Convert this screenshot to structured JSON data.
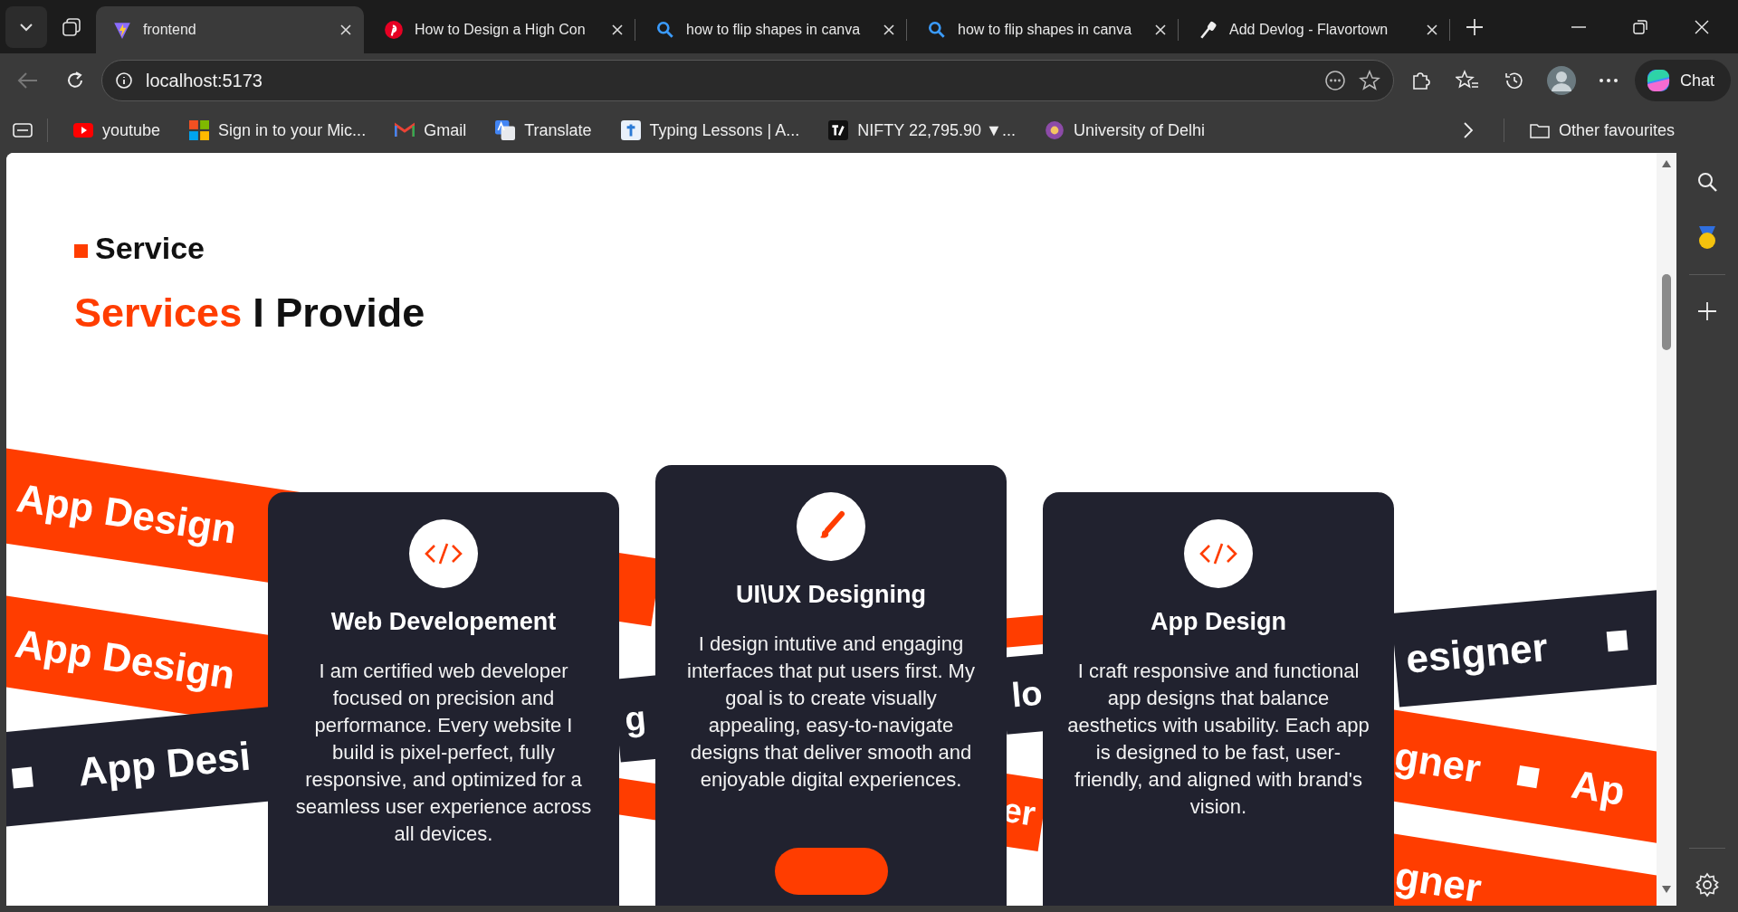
{
  "browser": {
    "tabs": [
      {
        "title": "frontend",
        "selected": true,
        "kind": "vite"
      },
      {
        "title": "How to Design a High Con",
        "selected": false,
        "kind": "pinterest"
      },
      {
        "title": "how to flip shapes in canva",
        "selected": false,
        "kind": "search"
      },
      {
        "title": "how to flip shapes in canva",
        "selected": false,
        "kind": "search"
      },
      {
        "title": "Add Devlog - Flavortown",
        "selected": false,
        "kind": "flavortown"
      }
    ],
    "back_disabled": true,
    "address": "localhost:5173",
    "chat_label": "Chat",
    "bookmarks": [
      {
        "label": "youtube",
        "kind": "youtube"
      },
      {
        "label": "Sign in to your Mic...",
        "kind": "microsoft"
      },
      {
        "label": "Gmail",
        "kind": "gmail"
      },
      {
        "label": "Translate",
        "kind": "translate"
      },
      {
        "label": "Typing Lessons | A...",
        "kind": "typing"
      },
      {
        "label": "NIFTY 22,795.90 ▼...",
        "kind": "chart"
      },
      {
        "label": "University of Delhi",
        "kind": "university"
      }
    ],
    "other_favourites": "Other favourites"
  },
  "page": {
    "eyebrow": "Service",
    "title_highlight": "Services",
    "title_rest": "I Provide",
    "ribbons": [
      {
        "color": "#ff3d00",
        "items": [
          {
            "kind": "text",
            "text": "App Design"
          }
        ]
      },
      {
        "color": "#ff3d00",
        "items": [
          {
            "kind": "text",
            "text": "App Design"
          }
        ]
      },
      {
        "color": "#21222f",
        "items": [
          {
            "kind": "square"
          },
          {
            "kind": "text",
            "text": "App Desi"
          }
        ]
      },
      {
        "color": "#ff3d00"
      },
      {
        "color": "#21222f",
        "items": [
          {
            "kind": "text",
            "text": "g"
          }
        ]
      },
      {
        "color": "#ff3d00"
      },
      {
        "color": "#ff3d00"
      },
      {
        "color": "#21222f",
        "items": [
          {
            "kind": "text",
            "text": "lo"
          }
        ]
      },
      {
        "color": "#ff3d00",
        "items": [
          {
            "kind": "text",
            "text": "er"
          }
        ]
      },
      {
        "color": "#21222f",
        "items": [
          {
            "kind": "text",
            "text": "esigner"
          },
          {
            "kind": "square"
          }
        ]
      },
      {
        "color": "#ff3d00",
        "items": [
          {
            "kind": "text",
            "text": "gner"
          },
          {
            "kind": "square"
          },
          {
            "kind": "text",
            "text": "Ap"
          }
        ]
      },
      {
        "color": "#ff3d00",
        "items": [
          {
            "kind": "text",
            "text": "gner"
          }
        ]
      }
    ],
    "cards": [
      {
        "kind": "code",
        "title": "Web Developement",
        "body": "I am certified web developer focused on precision and performance. Every website I build is pixel-perfect, fully responsive, and optimized for a seamless user experience across all devices.",
        "raised": false
      },
      {
        "kind": "brush",
        "title": "UI\\UX Designing",
        "body": "I design intutive and engaging interfaces that put users first. My goal is to create visually appealing, easy-to-navigate designs that deliver smooth and enjoyable digital experiences.",
        "raised": true
      },
      {
        "kind": "code",
        "title": "App Design",
        "body": "I craft responsive and functional app designs that balance aesthetics with usability. Each app is designed to be fast, user-friendly, and aligned with brand's vision.",
        "raised": false
      }
    ]
  }
}
